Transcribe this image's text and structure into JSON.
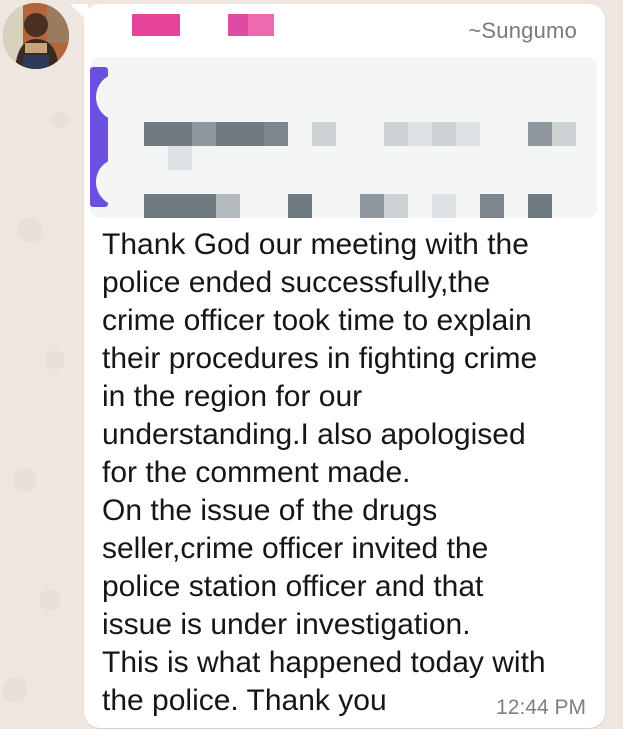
{
  "message": {
    "sender": "~Sungumo",
    "text": "Thank God our meeting with the\npolice ended successfully,the\ncrime officer took time to explain\ntheir procedures in fighting crime\nin the region for our\nunderstanding.I also apologised\nfor the comment made.\nOn the issue of the drugs\nseller,crime officer invited the\npolice station officer and that\nissue is under investigation.\nThis is what happened today with\nthe police. Thank you",
    "time": "12:44 PM"
  },
  "quoted_message": {
    "accent_color": "#6b4fe0",
    "redacted": true
  },
  "colors": {
    "chat_background": "#ede7df",
    "bubble": "#ffffff",
    "text": "#161616",
    "meta_text": "#7e7e7e",
    "redaction_pink": "#e6449a"
  }
}
